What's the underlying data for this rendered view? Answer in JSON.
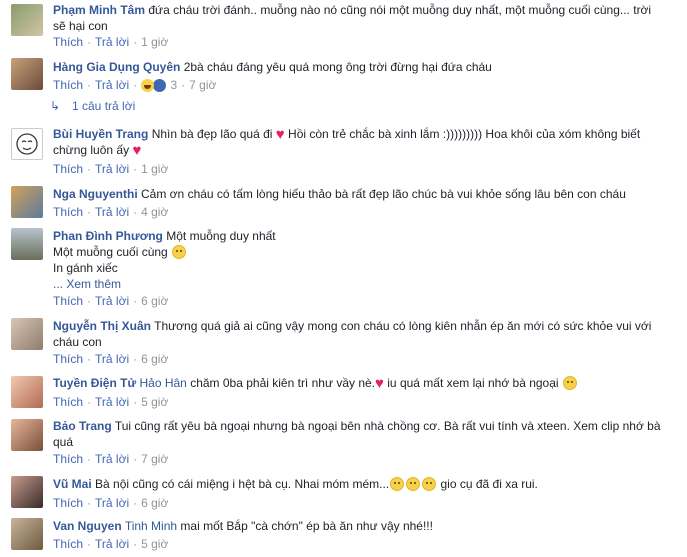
{
  "actions": {
    "like": "Thích",
    "reply": "Trả lời"
  },
  "comments": [
    {
      "author": "Phạm Minh Tâm",
      "text": "đứa cháu trời đánh.. muỗng nào nó cũng nói một muỗng duy nhất, một muỗng cuối cùng... trời sẽ hại con",
      "time": "1 giờ"
    },
    {
      "author": "Hàng Gia Dụng Quyên",
      "text": "2bà cháu đáng yêu quá mong ông trời đừng hại đứa cháu",
      "time": "7 giờ",
      "reaction_count": "3"
    },
    {
      "author": "Bùi Huyền Trang",
      "text_a": "Nhìn bà đẹp lão quá đi",
      "text_b": "Hồi còn trẻ chắc bà xinh lắm :))))))))) Hoa khôi của xóm không biết chừng luôn ấy",
      "time": "1 giờ"
    },
    {
      "author": "Nga Nguyenthi",
      "text": "Cảm ơn cháu có tấm lòng hiếu thảo bà rất đẹp lão chúc bà vui khỏe sống lâu bên con cháu",
      "time": "4 giờ"
    },
    {
      "author": "Phan Đình Phương",
      "line1": "Một muỗng duy nhất",
      "line2": "Một muỗng cuối cùng",
      "line3": "In gánh xiếc",
      "more": "... Xem thêm",
      "time": "6 giờ"
    },
    {
      "author": "Nguyễn Thị Xuân",
      "text": "Thương quá giả ai cũng vậy mong con cháu có lòng kiên nhẫn ép ăn mới có sức khỏe vui với cháu con",
      "time": "6 giờ"
    },
    {
      "author": "Tuyền Điện Tử",
      "tag": "Hảo Hân",
      "text_a": "chăm 0ba phải kiên trì như vầy nè.",
      "text_b": "iu quá mất xem lại nhớ bà ngoại",
      "time": "5 giờ"
    },
    {
      "author": "Bảo Trang",
      "text": "Tui cũng rất yêu bà ngoại nhưng bà ngoại bên nhà chồng cơ. Bà rất vui tính và xteen. Xem clip nhớ bà quá",
      "time": "7 giờ"
    },
    {
      "author": "Vũ Mai",
      "text_a": "Bà nội cũng có cái miệng i hệt bà cụ. Nhai móm mém...",
      "text_b": "gio cụ đã đi xa rui.",
      "time": "6 giờ"
    },
    {
      "author": "Van Nguyen",
      "tag": "Tinh Minh",
      "text": "mai mốt Bắp \"cà chớn\" ép bà ăn như vậy nhé!!!",
      "time": "5 giờ"
    }
  ],
  "replies_link": "1 câu trả lời",
  "colors": {
    "link": "#365899",
    "meta": "#90949c",
    "action": "#4267b2",
    "heart": "#e0245e"
  }
}
